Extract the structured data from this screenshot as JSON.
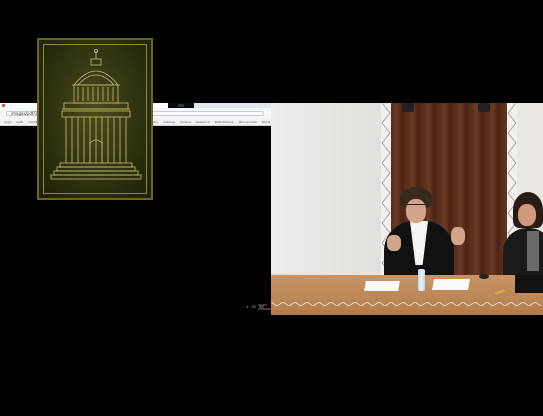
{
  "browser": {
    "tab_title": "Introduction to...",
    "url": "images/pdf/1b-r_Ringe",
    "bookmarks": [
      "Apps",
      "Lettr",
      "Gmail",
      "Cal",
      "Drive",
      "Docs",
      "Sheets",
      "Slides",
      "News",
      "Maps",
      "Photos",
      "Library",
      "Catalog",
      "Archive",
      "Research",
      "Bibliothèque",
      "Manuscripts",
      "Portal",
      "Exhibitions",
      "Catalogue",
      "Tools"
    ],
    "viewer_zoom": "1 · 52 · 85",
    "viewer_time": "12:03",
    "viewer_date": "23/04/2018"
  },
  "book": {
    "depicts": "tempietto-building-engraving"
  },
  "camera": {
    "scene": "panel-speakers"
  },
  "colors": {
    "background": "#000000",
    "wood": "#5a2e1c",
    "table": "#c99564",
    "book_cover": "#2f3310",
    "gold": "#c9bf6a"
  }
}
